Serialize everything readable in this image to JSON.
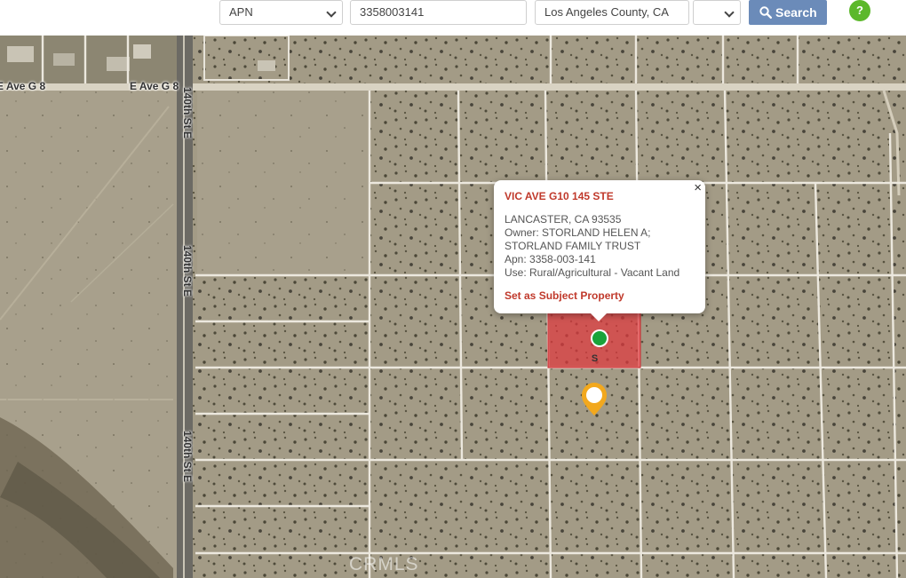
{
  "search": {
    "type_value": "APN",
    "query_value": "3358003141",
    "county_value": "Los Angeles County, CA",
    "extra_value": "",
    "button_label": "Search",
    "help_icon": "question-icon"
  },
  "map": {
    "road_labels": [
      "E Ave G 8",
      "E Ave G 8",
      "140th St E",
      "140th St E",
      "140th St E"
    ],
    "popup": {
      "title": "VIC AVE G10 145 STE",
      "city": "LANCASTER, CA 93535",
      "owner_line1": "Owner: STORLAND HELEN A;",
      "owner_line2": "STORLAND FAMILY TRUST",
      "apn": "Apn: 3358-003-141",
      "use": "Use: Rural/Agricultural - Vacant Land",
      "action": "Set as Subject Property",
      "close": "×"
    },
    "subject_marker_label": "S",
    "watermark": "CRMLS",
    "colors": {
      "selected_parcel": "#e0393e",
      "location_dot": "#1aa33a",
      "subject_marker": "#f2a81d",
      "popup_link": "#c0392b",
      "search_button": "#6b8bb9"
    }
  }
}
